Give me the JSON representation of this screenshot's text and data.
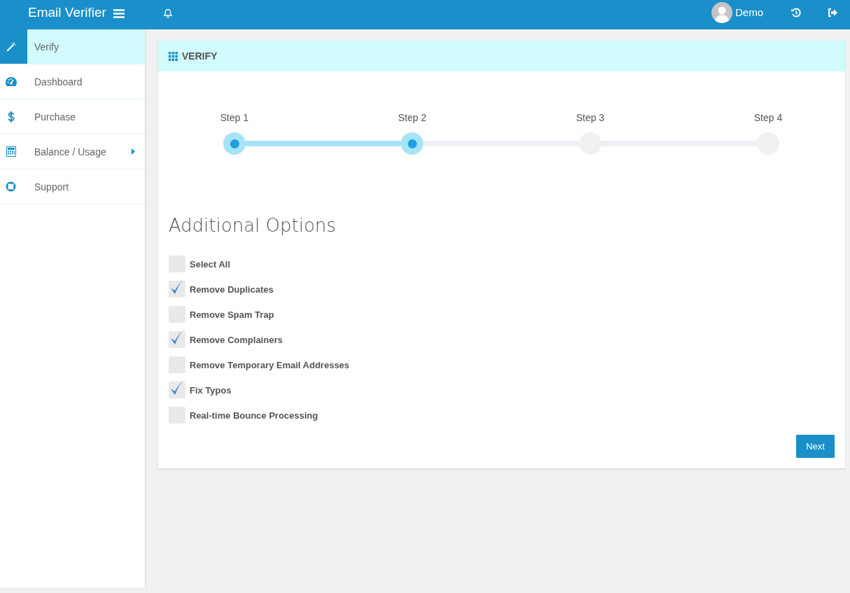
{
  "header": {
    "brand": "Email Verifier",
    "user": "Demo"
  },
  "sidebar": {
    "items": [
      {
        "label": "Verify",
        "selected": true,
        "has_submenu": false
      },
      {
        "label": "Dashboard",
        "selected": false,
        "has_submenu": false
      },
      {
        "label": "Purchase",
        "selected": false,
        "has_submenu": false
      },
      {
        "label": "Balance / Usage",
        "selected": false,
        "has_submenu": true
      },
      {
        "label": "Support",
        "selected": false,
        "has_submenu": false
      }
    ]
  },
  "panel": {
    "title": "VERIFY",
    "steps": [
      {
        "label": "Step 1",
        "active": true
      },
      {
        "label": "Step 2",
        "active": true
      },
      {
        "label": "Step 3",
        "active": false
      },
      {
        "label": "Step 4",
        "active": false
      }
    ],
    "heading": "Additional Options",
    "options": [
      {
        "label": "Select All",
        "checked": false
      },
      {
        "label": "Remove Duplicates",
        "checked": true
      },
      {
        "label": "Remove Spam Trap",
        "checked": false
      },
      {
        "label": "Remove Complainers",
        "checked": true
      },
      {
        "label": "Remove Temporary Email Addresses",
        "checked": false
      },
      {
        "label": "Fix Typos",
        "checked": true
      },
      {
        "label": "Real-time Bounce Processing",
        "checked": false
      }
    ],
    "button": "Next"
  }
}
